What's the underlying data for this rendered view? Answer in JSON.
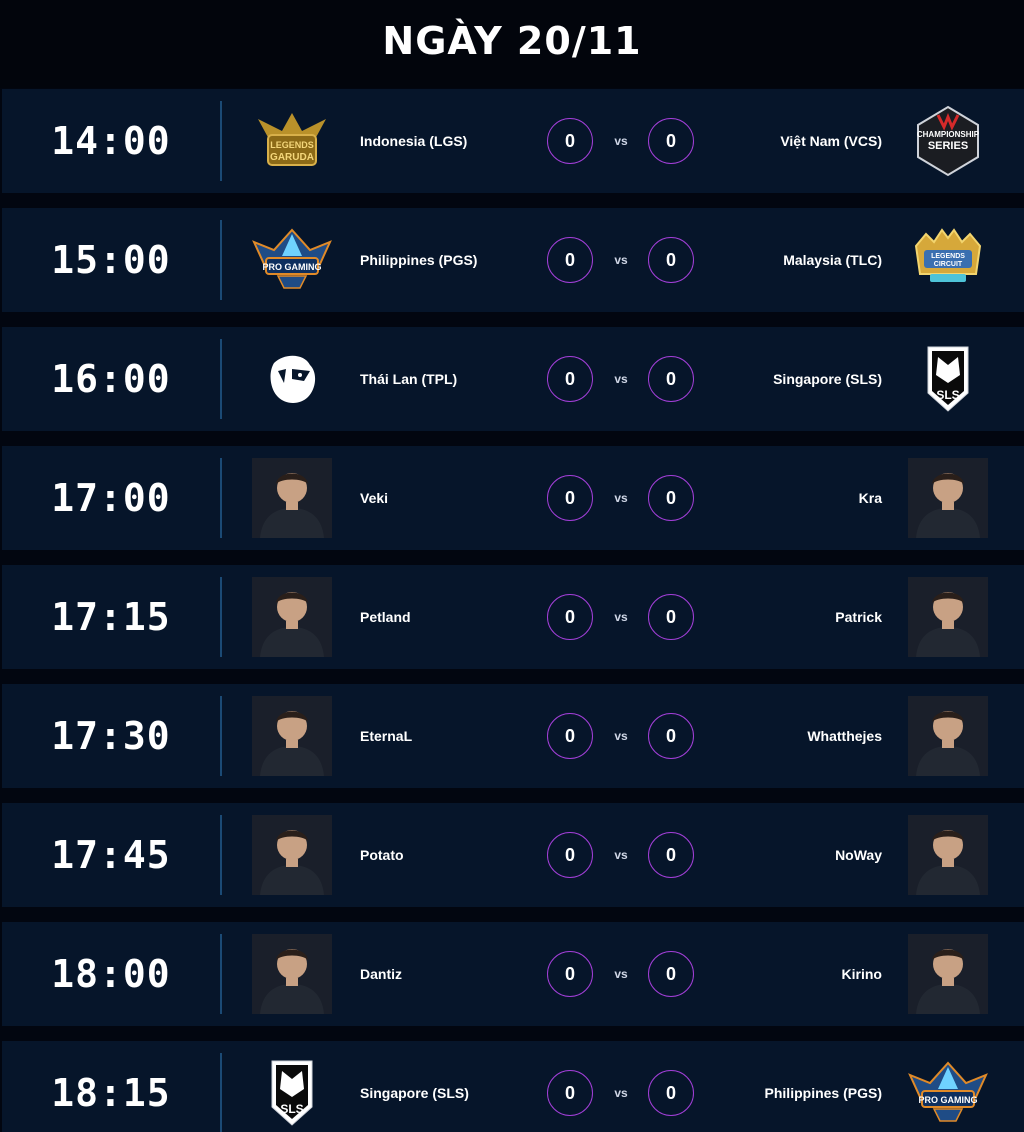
{
  "header": {
    "title": "NGÀY 20/11"
  },
  "accent_color": "#a23fd8",
  "matches": [
    {
      "time": "14:00",
      "left": {
        "name": "Indonesia (LGS)",
        "icon": "garuda-logo-icon"
      },
      "score_left": "0",
      "vs": "vs",
      "score_right": "0",
      "right": {
        "name": "Việt Nam (VCS)",
        "icon": "vcs-championship-logo-icon"
      }
    },
    {
      "time": "15:00",
      "left": {
        "name": "Philippines (PGS)",
        "icon": "pro-gaming-series-logo-icon"
      },
      "score_left": "0",
      "vs": "vs",
      "score_right": "0",
      "right": {
        "name": "Malaysia (TLC)",
        "icon": "legends-circuit-logo-icon"
      }
    },
    {
      "time": "16:00",
      "left": {
        "name": "Thái Lan (TPL)",
        "icon": "lion-head-logo-icon"
      },
      "score_left": "0",
      "vs": "vs",
      "score_right": "0",
      "right": {
        "name": "Singapore (SLS)",
        "icon": "sls-shield-logo-icon"
      }
    },
    {
      "time": "17:00",
      "left": {
        "name": "Veki",
        "icon": "player-avatar-icon"
      },
      "score_left": "0",
      "vs": "vs",
      "score_right": "0",
      "right": {
        "name": "Kra",
        "icon": "player-avatar-icon"
      }
    },
    {
      "time": "17:15",
      "left": {
        "name": "Petland",
        "icon": "player-avatar-icon"
      },
      "score_left": "0",
      "vs": "vs",
      "score_right": "0",
      "right": {
        "name": "Patrick",
        "icon": "player-avatar-icon"
      }
    },
    {
      "time": "17:30",
      "left": {
        "name": "EternaL",
        "icon": "player-avatar-icon"
      },
      "score_left": "0",
      "vs": "vs",
      "score_right": "0",
      "right": {
        "name": "Whatthejes",
        "icon": "player-avatar-icon"
      }
    },
    {
      "time": "17:45",
      "left": {
        "name": "Potato",
        "icon": "player-avatar-icon"
      },
      "score_left": "0",
      "vs": "vs",
      "score_right": "0",
      "right": {
        "name": "NoWay",
        "icon": "player-avatar-icon"
      }
    },
    {
      "time": "18:00",
      "left": {
        "name": "Dantiz",
        "icon": "player-avatar-icon"
      },
      "score_left": "0",
      "vs": "vs",
      "score_right": "0",
      "right": {
        "name": "Kirino",
        "icon": "player-avatar-icon"
      }
    },
    {
      "time": "18:15",
      "left": {
        "name": "Singapore (SLS)",
        "icon": "sls-shield-logo-icon"
      },
      "score_left": "0",
      "vs": "vs",
      "score_right": "0",
      "right": {
        "name": "Philippines (PGS)",
        "icon": "pro-gaming-series-logo-icon"
      }
    }
  ]
}
